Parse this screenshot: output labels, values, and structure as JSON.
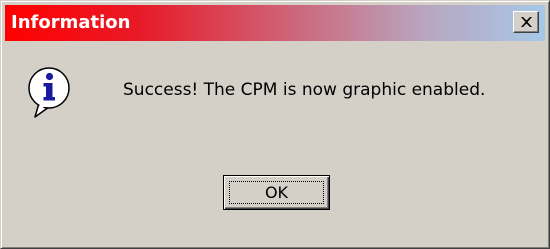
{
  "window": {
    "title": "Information",
    "close_icon": "close-icon"
  },
  "body": {
    "icon": "information-icon",
    "message": "Success! The CPM is now graphic enabled."
  },
  "buttons": {
    "ok_label": "OK"
  },
  "colors": {
    "dialog_background": "#d4d0c8",
    "title_gradient_start": "#ff0000",
    "title_gradient_end": "#a6c8e8",
    "title_text": "#ffffff",
    "icon_blue": "#1a1aa0"
  }
}
